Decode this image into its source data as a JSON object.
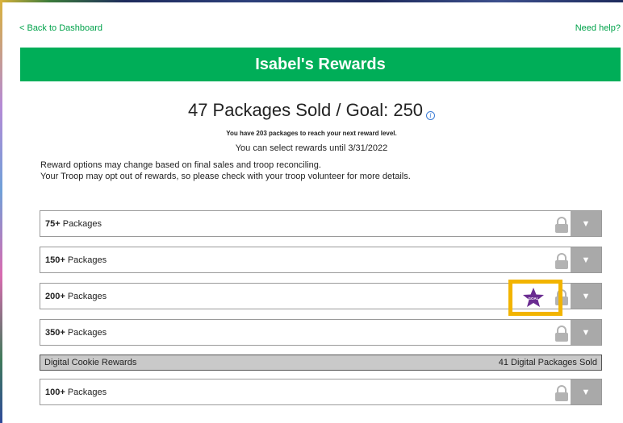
{
  "nav": {
    "back_label": "< Back to Dashboard",
    "help_label": "Need help?"
  },
  "banner": {
    "title": "Isabel's Rewards"
  },
  "summary": {
    "headline": "47 Packages Sold / Goal: 250",
    "info_icon": "info-icon",
    "remaining": "You have 203 packages to reach your next reward level.",
    "deadline": "You can select rewards until 3/31/2022",
    "note_1": "Reward options may change based on final sales and troop reconciling.",
    "note_2": "Your Troop may opt out of rewards, so please check with your troop volunteer for more details."
  },
  "reward_levels": [
    {
      "count": "75+",
      "suffix": " Packages",
      "icon": "lock-icon"
    },
    {
      "count": "150+",
      "suffix": " Packages",
      "icon": "lock-icon"
    },
    {
      "count": "200+",
      "suffix": " Packages",
      "icon": "lock-icon",
      "goal_badge": "GOAL"
    },
    {
      "count": "350+",
      "suffix": " Packages",
      "icon": "lock-icon"
    },
    {
      "count": "100+",
      "suffix": " Packages",
      "icon": "lock-icon"
    }
  ],
  "digital": {
    "label": "Digital Cookie Rewards",
    "sold": "41 Digital Packages Sold"
  },
  "colors": {
    "brand_green": "#00ae58",
    "link_green": "#00a24a",
    "goal_purple": "#6a2c91",
    "highlight_yellow": "#f2b400",
    "expand_gray": "#a9a9a9"
  }
}
